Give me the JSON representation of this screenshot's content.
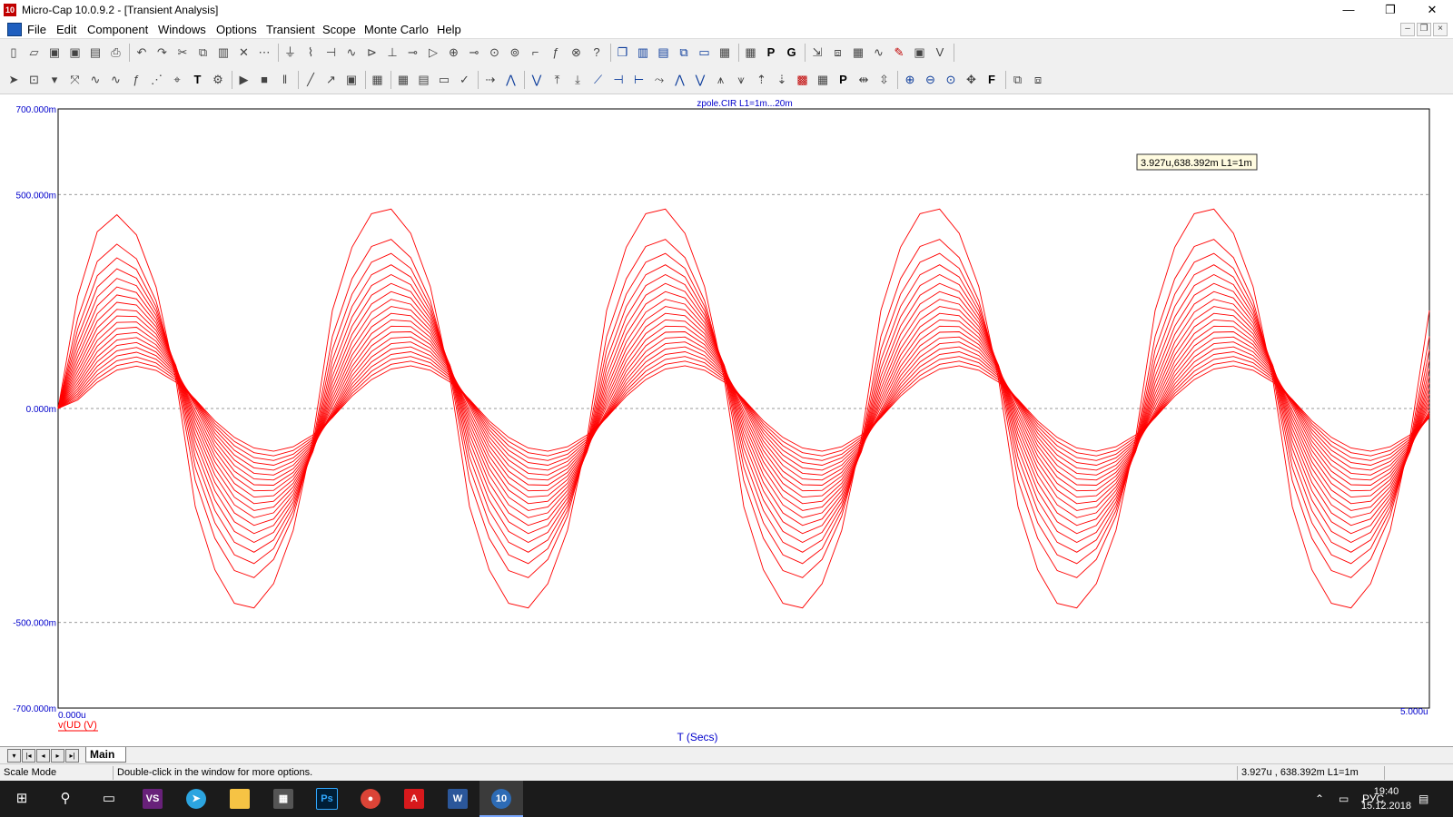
{
  "window": {
    "title": "Micro-Cap 10.0.9.2 - [Transient Analysis]",
    "app_icon_text": "10",
    "min_glyph": "—",
    "restore_glyph": "❐",
    "close_glyph": "✕"
  },
  "menu": {
    "items": [
      {
        "label": "File"
      },
      {
        "label": "Edit"
      },
      {
        "label": "Component"
      },
      {
        "label": "Windows"
      },
      {
        "label": "Options"
      },
      {
        "label": "Transient"
      },
      {
        "label": "Scope"
      },
      {
        "label": "Monte Carlo"
      },
      {
        "label": "Help"
      }
    ],
    "mdi_min": "–",
    "mdi_restore": "❐",
    "mdi_close": "×"
  },
  "toolbar1": {
    "icons": [
      "new-file-icon",
      "open-icon",
      "save-icon",
      "save-all-icon",
      "print-preview-icon",
      "print-icon",
      "undo-icon",
      "redo-icon",
      "cut-icon",
      "copy-icon",
      "paste-icon",
      "delete-icon",
      "select-all-icon",
      "ground-icon",
      "resistor-icon",
      "capacitor-icon",
      "inductor-icon",
      "diode-icon",
      "battery-icon",
      "npn-icon",
      "opamp-icon",
      "source-icon",
      "pin-icon",
      "vsource-icon",
      "isource-icon",
      "wire-icon",
      "fx-icon",
      "find-icon",
      "help-icon",
      "cascade-icon",
      "tile-vertical-icon",
      "tile-horizontal-icon",
      "overlap-icon",
      "window-icon",
      "calculator-icon",
      "grid-icon",
      "p-icon",
      "g-icon",
      "probe-icon",
      "analysis-icon",
      "stepping-icon",
      "sine-icon",
      "pen-icon",
      "image-icon",
      "vd-icon"
    ]
  },
  "toolbar2": {
    "icons": [
      "pointer-icon",
      "zoom-box-icon",
      "dropdown-icon",
      "scale-icon",
      "cursor-icon",
      "cursor2-icon",
      "fx-cursor-icon",
      "data-points-icon",
      "tag-icon",
      "text-icon",
      "properties-icon",
      "run-icon",
      "stop-icon",
      "pause-icon",
      "line-icon",
      "arrow-icon",
      "box-icon",
      "grid-icon",
      "minor-grid-icon",
      "table-icon",
      "ruler-icon",
      "tick-icon",
      "mark-icon",
      "peak-icon",
      "valley-icon",
      "high-icon",
      "low-icon",
      "slope-icon",
      "left-cursor-icon",
      "right-cursor-icon",
      "inflection-icon",
      "next-peak-icon",
      "prev-valley-icon",
      "global-high-icon",
      "global-low-icon",
      "top-icon",
      "bottom-icon",
      "color-icon",
      "numeric-icon",
      "point-tag-icon",
      "horizontal-tag-icon",
      "vertical-tag-icon",
      "zoom-in-icon",
      "zoom-out-icon",
      "zoom-fit-icon",
      "pan-icon",
      "font-icon",
      "copy-plot-icon",
      "restore-plot-icon"
    ]
  },
  "plot": {
    "header": "zpole.CIR L1=1m...20m",
    "tooltip": "3.927u,638.392m L1=1m",
    "xlabel": "T (Secs)",
    "ylabel": "v(UD (V)",
    "x_min_label": "0.000u",
    "x_max_label": "5.000u",
    "trace_color": "#ff0000",
    "axis_color": "#0000cc"
  },
  "chart_data": {
    "type": "line",
    "xlabel": "T (Secs)",
    "ylabel": "v(UD (V)",
    "xlim": [
      0,
      5e-06
    ],
    "ylim": [
      -0.7,
      0.7
    ],
    "y_ticks": [
      {
        "value": 0.7,
        "label": "700.000m"
      },
      {
        "value": 0.5,
        "label": "500.000m"
      },
      {
        "value": 0.0,
        "label": "0.000m"
      },
      {
        "value": -0.5,
        "label": "-500.000m"
      },
      {
        "value": -0.7,
        "label": "-700.000m"
      }
    ],
    "dashed_grid_y": [
      0.5,
      0.0,
      -0.5
    ],
    "cursor_readout": {
      "t": "3.927u",
      "v": "638.392m",
      "param": "L1=1m"
    },
    "series_family": {
      "parameter": "L1",
      "range": "1m...20m",
      "count": 20,
      "periods_shown": 5,
      "first_peak_t": 2.8e-07,
      "peak_amplitude_max": 0.47,
      "trough_amplitude_max": -0.47,
      "peak_amplitude_min": 0.1,
      "trough_amplitude_min": -0.1
    }
  },
  "tabs": {
    "active": "Main"
  },
  "status": {
    "mode": "Scale Mode",
    "hint": "Double-click in the window for more options.",
    "readout": "3.927u , 638.392m L1=1m"
  },
  "taskbar": {
    "lang": "РУС",
    "time": "19:40",
    "date": "15.12.2018",
    "apps": [
      "windows-start-icon",
      "search-icon",
      "task-view-icon",
      "visual-studio-icon",
      "telegram-icon",
      "file-explorer-icon",
      "calculator-app-icon",
      "photoshop-icon",
      "chrome-icon",
      "acrobat-icon",
      "word-icon",
      "microcap-icon"
    ]
  }
}
